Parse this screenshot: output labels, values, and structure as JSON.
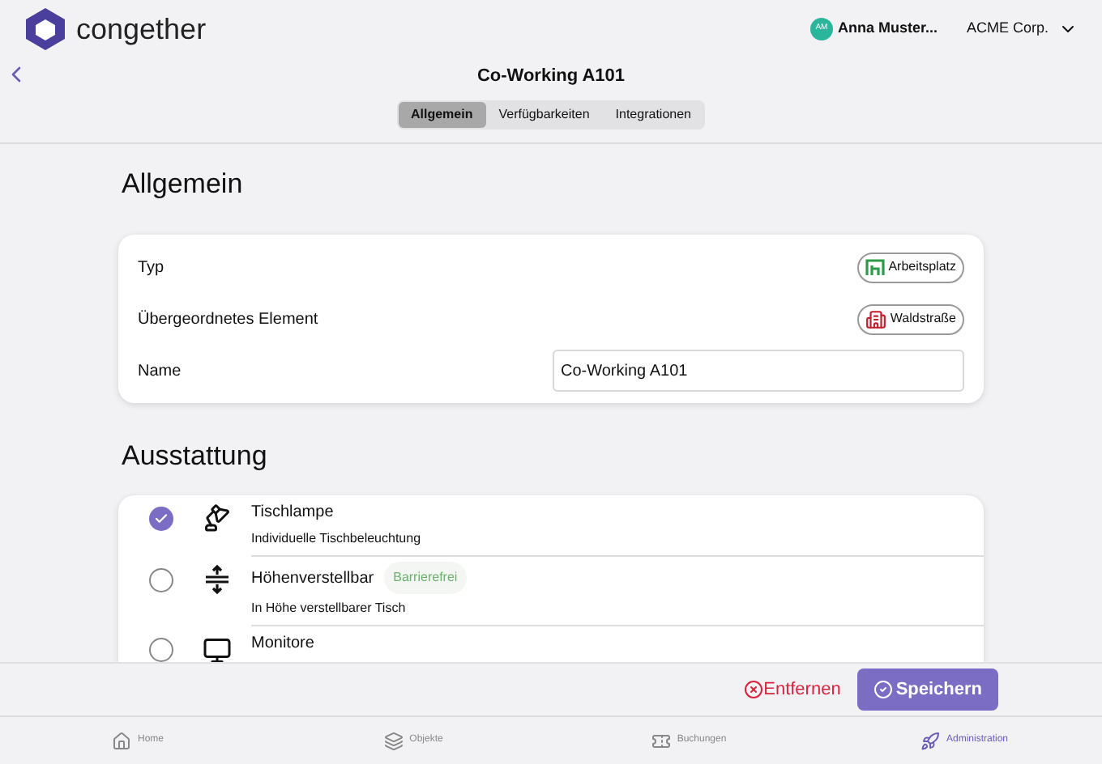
{
  "header": {
    "logo_text": "congether",
    "user": {
      "initials": "AM",
      "name": "Anna Muster..."
    },
    "organization": "ACME Corp."
  },
  "page": {
    "title": "Co-Working A101"
  },
  "tabs": [
    {
      "label": "Allgemein",
      "selected": true
    },
    {
      "label": "Verfügbarkeiten",
      "selected": false
    },
    {
      "label": "Integrationen",
      "selected": false
    }
  ],
  "general": {
    "heading": "Allgemein",
    "fields": [
      {
        "kind": "chip",
        "label": "Typ",
        "value": "Arbeitsplatz"
      },
      {
        "kind": "location",
        "label": "Übergeordnetes Element",
        "value": "Waldstraße"
      },
      {
        "kind": "input",
        "label": "Name",
        "value": "Co-Working A101"
      }
    ]
  },
  "equipment": {
    "heading": "Ausstattung",
    "items": [
      {
        "kind": "lamp",
        "checked": true,
        "title": "Tischlampe",
        "description": "Individuelle Tischbeleuchtung"
      },
      {
        "kind": "height",
        "checked": false,
        "title": "Höhenverstellbar",
        "tag": "Barrierefrei",
        "description": "In Höhe verstellbarer Tisch"
      },
      {
        "kind": "monitor",
        "checked": false,
        "title": "Monitore"
      }
    ]
  },
  "actions": {
    "remove": "Entfernen",
    "save": "Speichern"
  },
  "nav": [
    {
      "kind": "home",
      "label": "Home",
      "selected": false
    },
    {
      "kind": "objects",
      "label": "Objekte",
      "selected": false
    },
    {
      "kind": "bookings",
      "label": "Buchungen",
      "selected": false
    },
    {
      "kind": "admin",
      "label": "Administration",
      "selected": true
    }
  ]
}
